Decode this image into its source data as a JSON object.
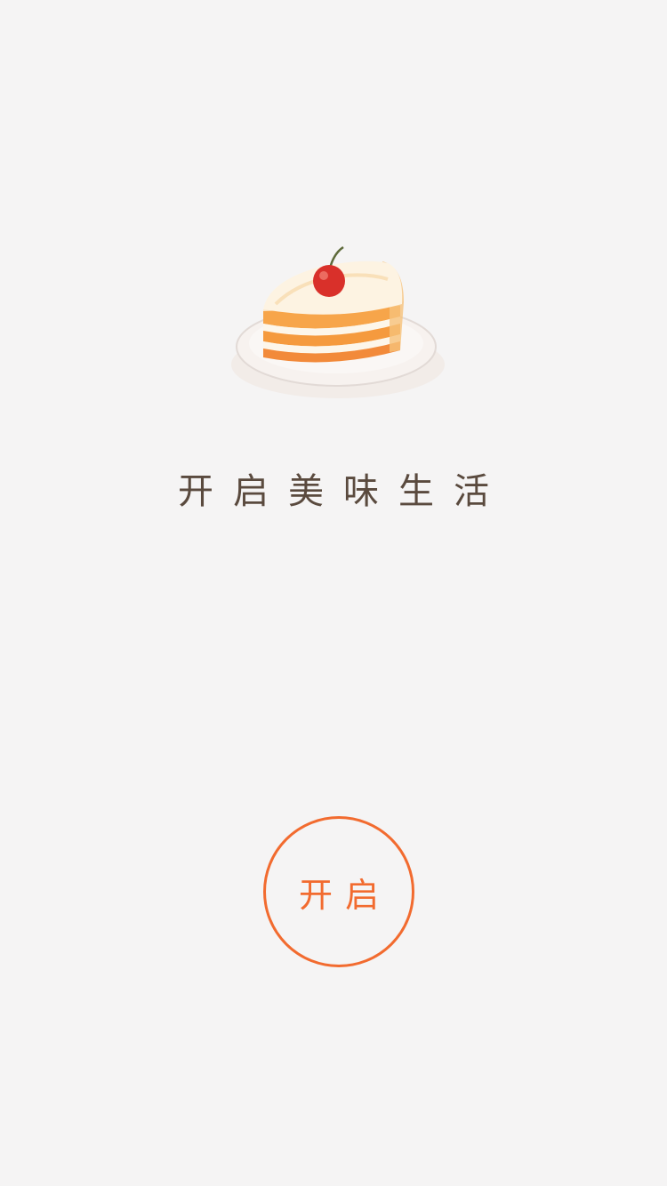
{
  "splash": {
    "illustration": "cake-slice-with-cherry",
    "tagline": "开启美味生活",
    "start_label": "开启"
  },
  "colors": {
    "background": "#f5f4f4",
    "accent": "#f26b2f",
    "tagline_text": "#5a4a3e"
  }
}
